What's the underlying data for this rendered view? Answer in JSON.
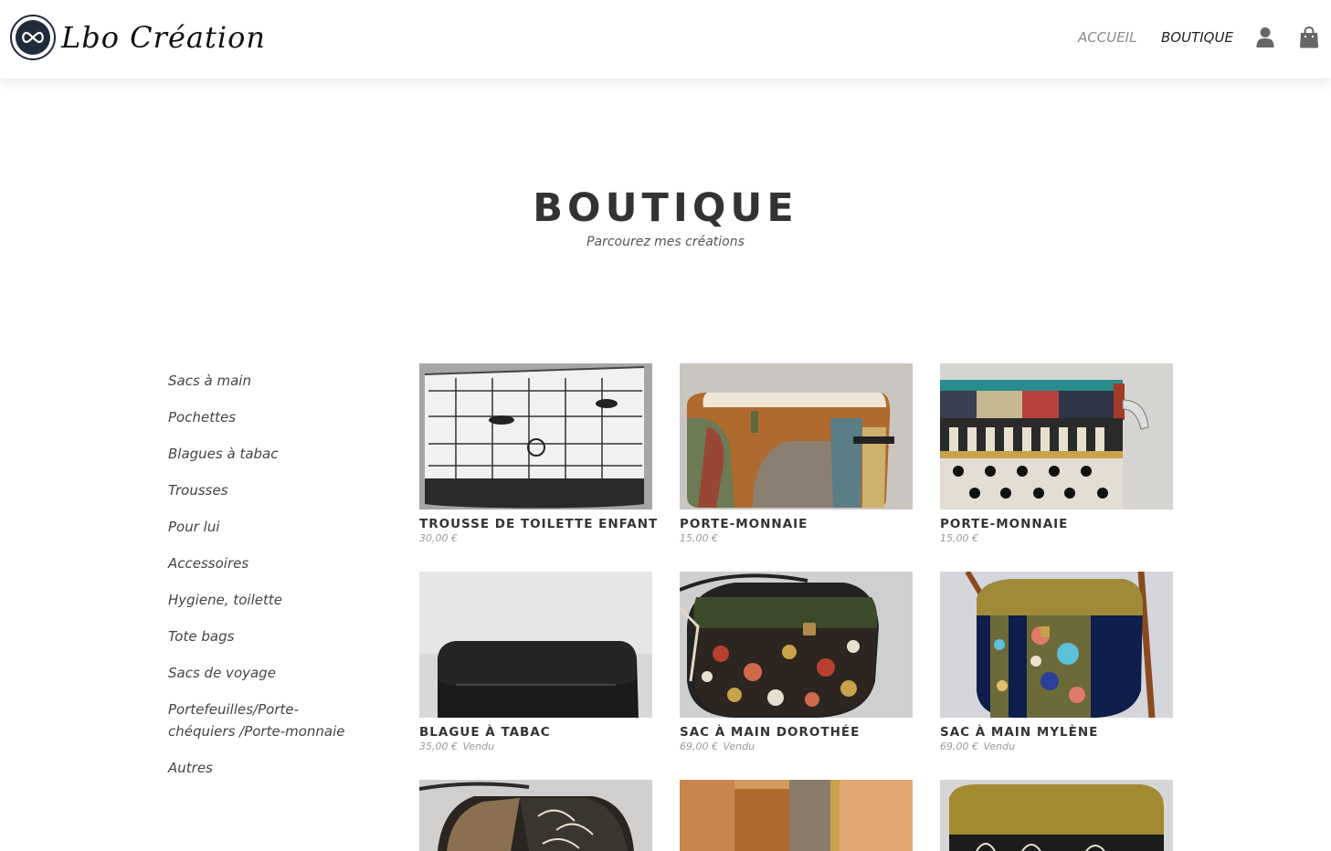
{
  "header": {
    "logo_text": "Lbo Création",
    "logo_badge_text": "LBO CRÉATION",
    "nav": [
      {
        "label": "ACCUEIL",
        "active": false
      },
      {
        "label": "BOUTIQUE",
        "active": true
      }
    ],
    "icons": [
      "user-icon",
      "shopping-bag-icon"
    ]
  },
  "page": {
    "title": "BOUTIQUE",
    "subtitle": "Parcourez mes créations"
  },
  "sidebar": {
    "categories": [
      "Sacs à main",
      "Pochettes",
      "Blagues à tabac",
      "Trousses",
      "Pour lui",
      "Accessoires",
      "Hygiene, toilette",
      "Tote bags",
      "Sacs de voyage",
      "Portefeuilles/Porte-chéquiers /Porte-monnaie",
      "Autres"
    ]
  },
  "products": [
    {
      "name": "TROUSSE DE TOILETTE ENFANT",
      "price": "30,00 €",
      "status": ""
    },
    {
      "name": "PORTE-MONNAIE",
      "price": "15,00 €",
      "status": ""
    },
    {
      "name": "PORTE-MONNAIE",
      "price": "15,00 €",
      "status": ""
    },
    {
      "name": "BLAGUE À TABAC",
      "price": "35,00 €",
      "status": "Vendu"
    },
    {
      "name": "SAC À MAIN DOROTHÉE",
      "price": "69,00 €",
      "status": "Vendu"
    },
    {
      "name": "SAC À MAIN MYLÈNE",
      "price": "69,00 €",
      "status": "Vendu"
    },
    {
      "name": "",
      "price": "",
      "status": ""
    },
    {
      "name": "",
      "price": "",
      "status": ""
    },
    {
      "name": "",
      "price": "",
      "status": ""
    }
  ],
  "colors": {
    "text": "#333333",
    "muted": "#999999",
    "nav_inactive": "#8a8a8a",
    "logo_navy": "#1f2b3a"
  }
}
